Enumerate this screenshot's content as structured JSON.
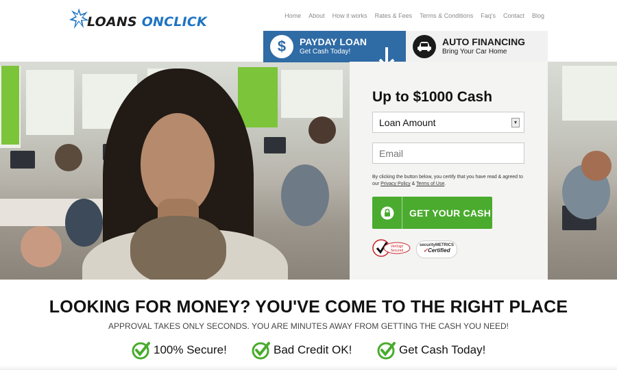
{
  "brand": {
    "name_part1": "LOANS",
    "name_part2": "ONCLICK",
    "accent": "#1e74c2"
  },
  "nav": {
    "items": [
      "Home",
      "About",
      "How it works",
      "Rates & Fees",
      "Terms & Conditions",
      "Faq's",
      "Contact",
      "Blog"
    ]
  },
  "tabs": {
    "payday": {
      "title": "PAYDAY LOAN",
      "subtitle": "Get Cash Today!",
      "icon": "dollar-icon",
      "active": true
    },
    "auto": {
      "title": "AUTO FINANCING",
      "subtitle": "Bring Your Car Home",
      "icon": "car-icon",
      "active": false
    }
  },
  "form": {
    "title": "Up to $1000 Cash",
    "amount_select": {
      "selected": "Loan Amount"
    },
    "email": {
      "placeholder": "Email"
    },
    "legal": {
      "prefix": "By clicking the button below, you certify that you have read & agreed to our",
      "privacy_link": "Privacy Policy",
      "amp": "&",
      "terms_link": "Terms of Use",
      "suffix": "."
    },
    "submit_label": "GET YOUR CASH",
    "badges": {
      "verisign_line1": "VeriSign",
      "verisign_line2": "Secured",
      "metrics_line1": "securityMETRICS",
      "metrics_line2": "Certified"
    }
  },
  "headline": "LOOKING FOR MONEY? YOU'VE COME TO THE RIGHT PLACE",
  "subheadline": "APPROVAL TAKES ONLY SECONDS. YOU ARE MINUTES AWAY FROM GETTING THE CASH YOU NEED!",
  "features": [
    "100% Secure!",
    "Bad Credit OK!",
    "Get Cash Today!"
  ],
  "colors": {
    "tab_active": "#2f6ba5",
    "button_green": "#4aab2e",
    "check_green": "#4aab2e"
  }
}
